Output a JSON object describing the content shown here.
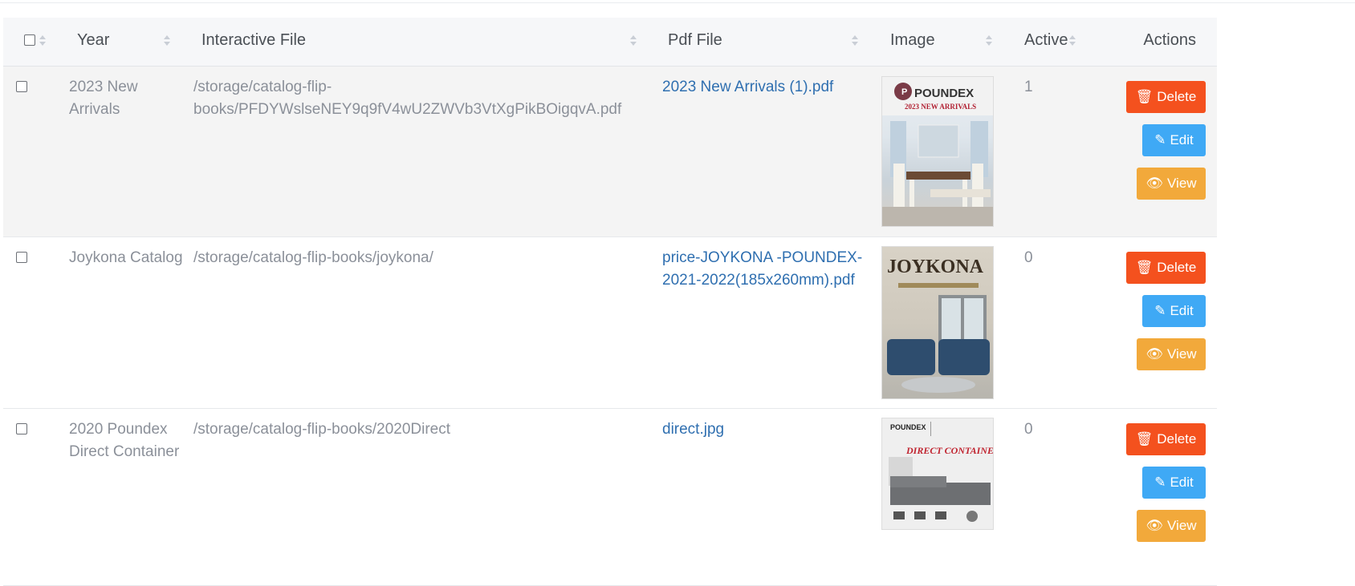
{
  "table": {
    "headers": {
      "year": "Year",
      "interactive_file": "Interactive File",
      "pdf_file": "Pdf File",
      "image": "Image",
      "active": "Active",
      "actions": "Actions"
    },
    "rows": [
      {
        "year": "2023 New Arrivals",
        "interactive_file": "/storage/catalog-flip-books/PFDYWslseNEY9q9fV4wU2ZWVb3VtXgPikBOigqvA.pdf",
        "pdf_file": "2023 New Arrivals (1).pdf",
        "active": "1",
        "image": {
          "brand": "POUNDEX",
          "caption": "2023 NEW ARRIVALS"
        }
      },
      {
        "year": "Joykona Catalog",
        "interactive_file": "/storage/catalog-flip-books/joykona/",
        "pdf_file": "price-JOYKONA -POUNDEX-2021-2022(185x260mm).pdf",
        "active": "0",
        "image": {
          "brand": "JOYKONA",
          "caption": ""
        }
      },
      {
        "year": "2020 Poundex Direct Container",
        "interactive_file": "/storage/catalog-flip-books/2020Direct",
        "pdf_file": "direct.jpg",
        "active": "0",
        "image": {
          "brand": "POUNDEX",
          "caption": "DIRECT CONTAINER"
        }
      }
    ],
    "buttons": {
      "delete": "Delete",
      "edit": "Edit",
      "view": "View"
    }
  },
  "colors": {
    "delete": "#f4511e",
    "edit": "#3fa9f5",
    "view": "#f2a93b",
    "link": "#2f6fb0"
  },
  "icons": {
    "delete": "trash-icon",
    "edit": "edit-icon",
    "view": "eye-icon",
    "sort": "sort-icon"
  }
}
